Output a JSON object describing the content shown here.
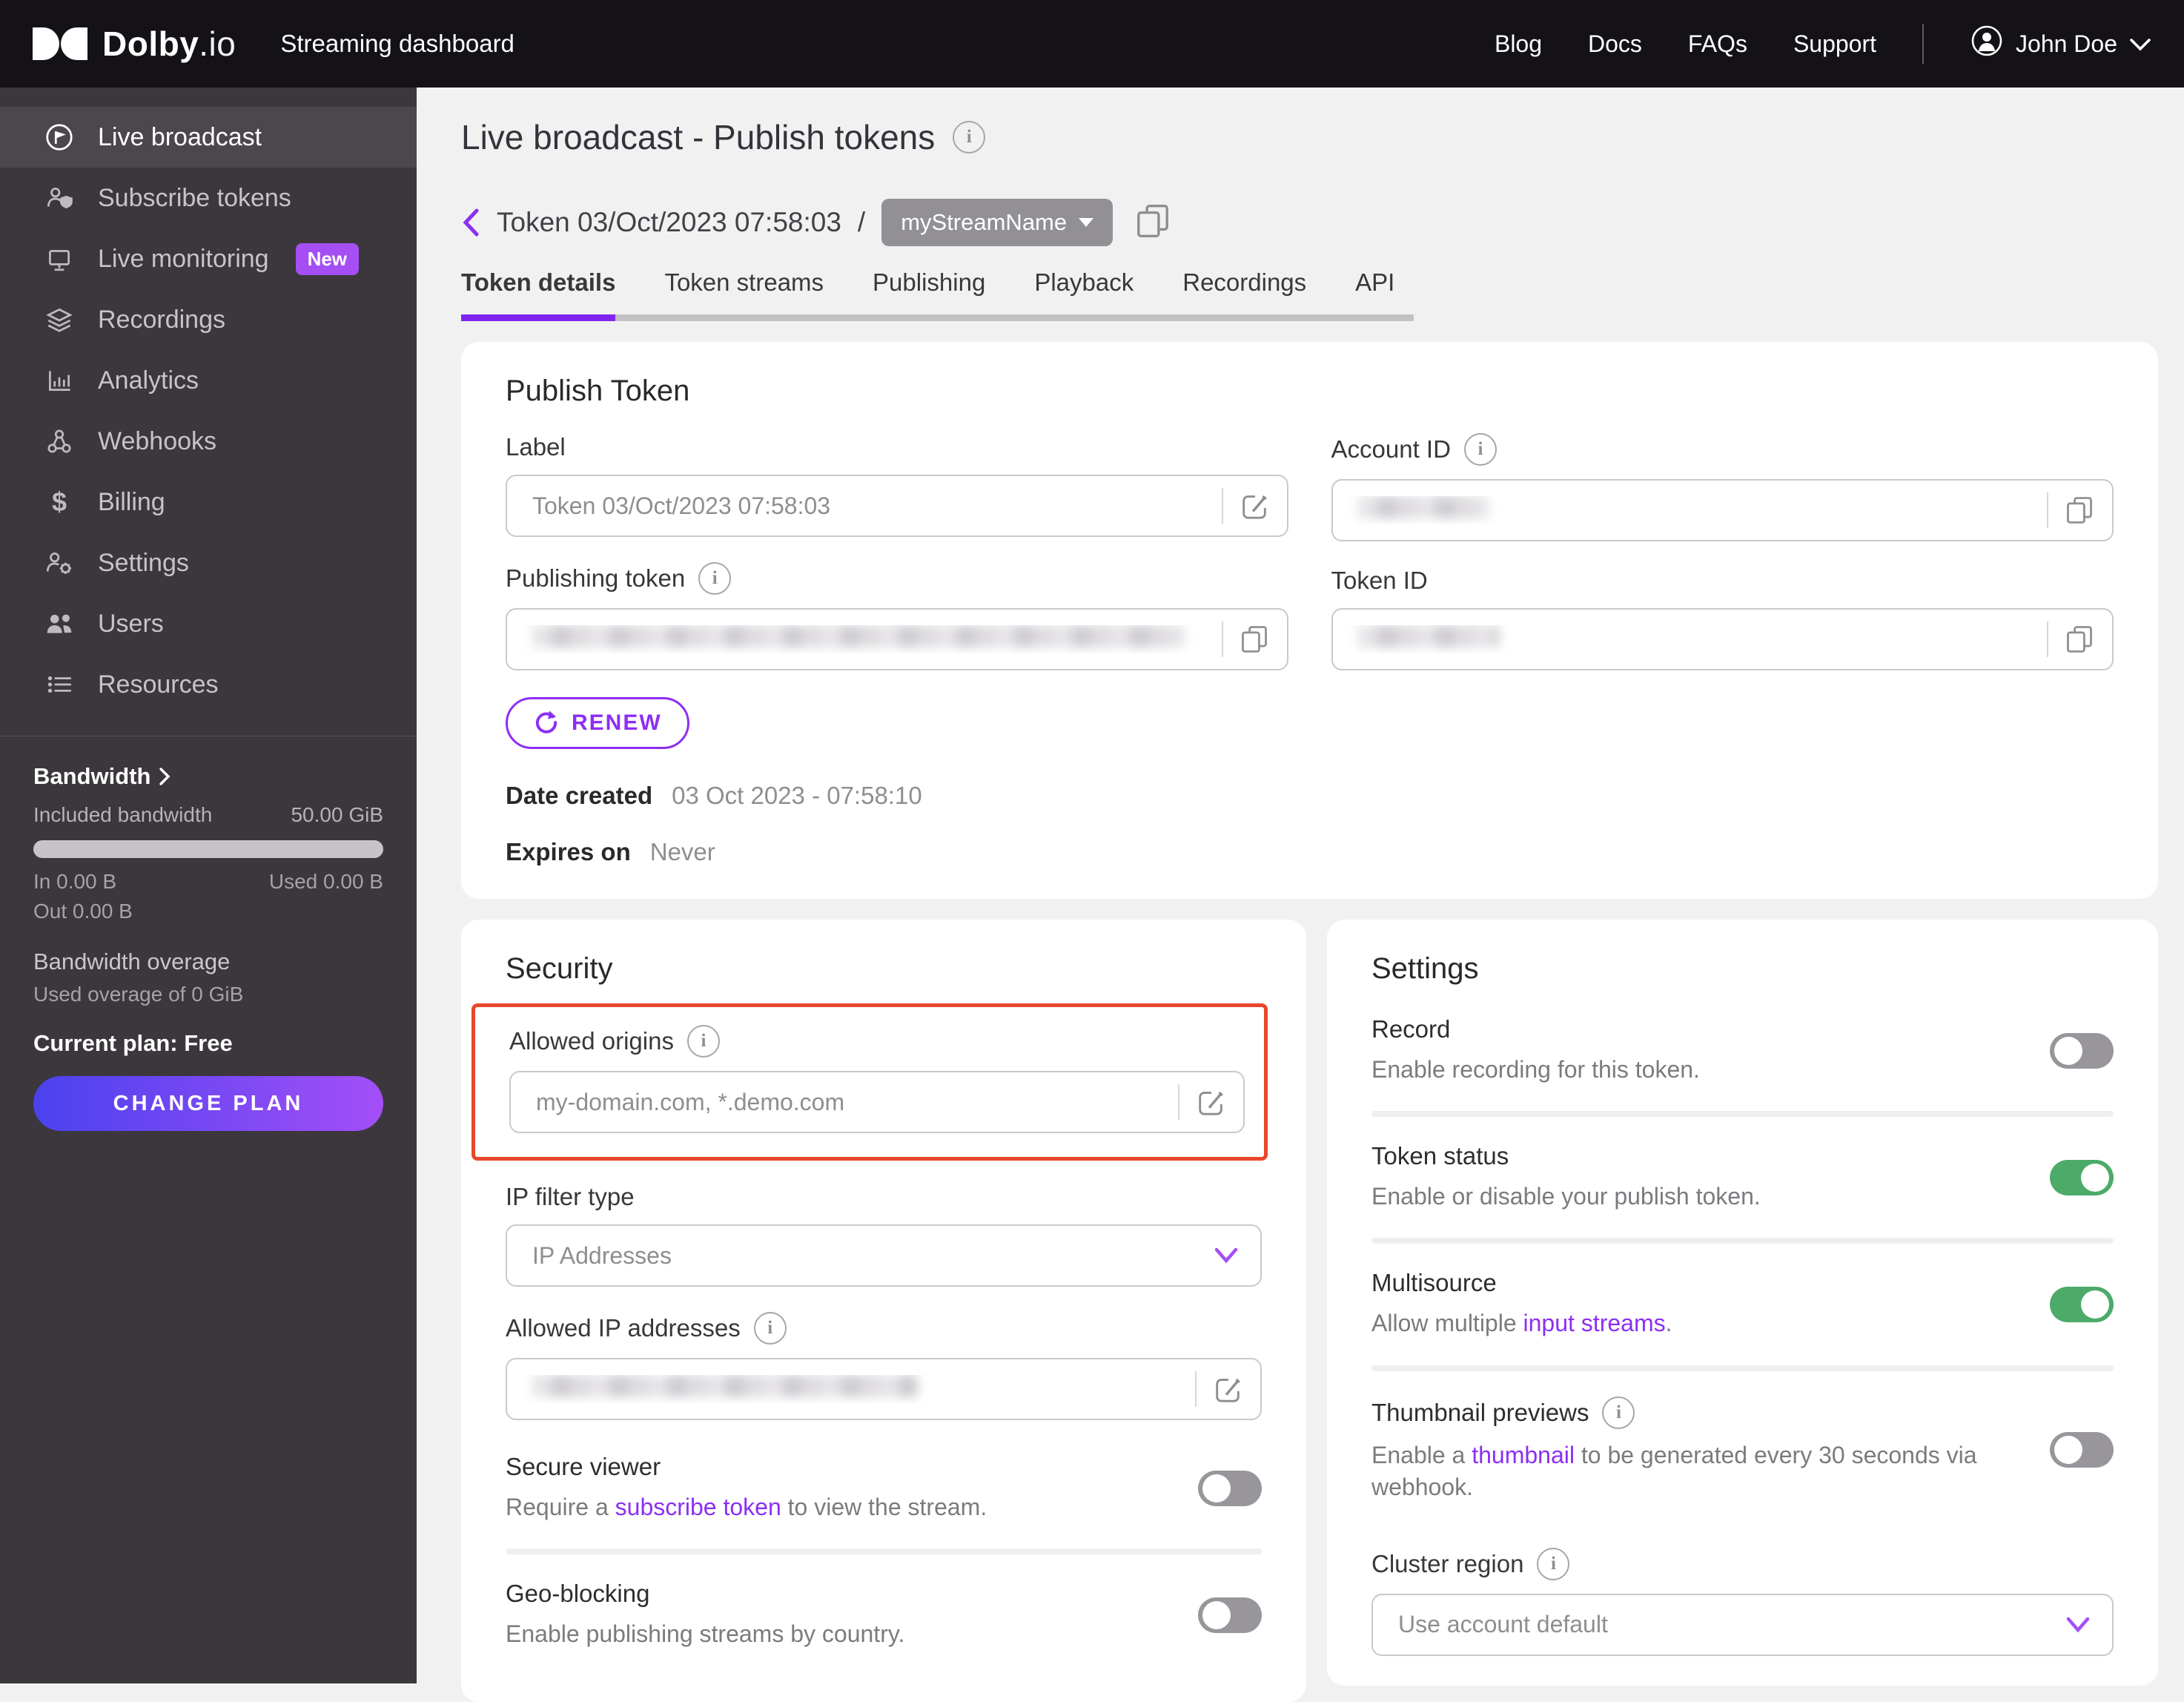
{
  "topbar": {
    "brand_bold": "Dolby",
    "brand_suffix": ".io",
    "product": "Streaming dashboard",
    "links": [
      {
        "label": "Blog"
      },
      {
        "label": "Docs"
      },
      {
        "label": "FAQs"
      },
      {
        "label": "Support"
      }
    ],
    "user": "John Doe"
  },
  "sidebar": {
    "items": [
      {
        "label": "Live broadcast"
      },
      {
        "label": "Subscribe tokens"
      },
      {
        "label": "Live monitoring",
        "badge": "New"
      },
      {
        "label": "Recordings"
      },
      {
        "label": "Analytics"
      },
      {
        "label": "Webhooks"
      },
      {
        "label": "Billing"
      },
      {
        "label": "Settings"
      },
      {
        "label": "Users"
      },
      {
        "label": "Resources"
      }
    ],
    "icons": {
      "billing": "$"
    },
    "bandwidth": {
      "title": "Bandwidth",
      "included_label": "Included bandwidth",
      "included_value": "50.00 GiB",
      "in": "In 0.00 B",
      "used": "Used 0.00 B",
      "out": "Out 0.00 B",
      "overage_title": "Bandwidth overage",
      "overage_desc": "Used overage of 0 GiB",
      "plan": "Current plan: Free",
      "change_plan": "CHANGE PLAN"
    }
  },
  "page": {
    "title": "Live broadcast - Publish tokens",
    "breadcrumb": {
      "token": "Token 03/Oct/2023 07:58:03",
      "separator": "/",
      "stream_pill": "myStreamName"
    },
    "tabs": [
      {
        "label": "Token details"
      },
      {
        "label": "Token streams"
      },
      {
        "label": "Publishing"
      },
      {
        "label": "Playback"
      },
      {
        "label": "Recordings"
      },
      {
        "label": "API"
      }
    ],
    "active_tab": "Token details"
  },
  "publish_token": {
    "heading": "Publish Token",
    "label_label": "Label",
    "label_value": "Token 03/Oct/2023 07:58:03",
    "account_id_label": "Account ID",
    "publishing_token_label": "Publishing token",
    "token_id_label": "Token ID",
    "renew_label": "RENEW",
    "date_created_label": "Date created",
    "date_created_value": "03 Oct 2023 - 07:58:10",
    "expires_label": "Expires on",
    "expires_value": "Never"
  },
  "security": {
    "heading": "Security",
    "allowed_origins_label": "Allowed origins",
    "allowed_origins_placeholder": "my-domain.com, *.demo.com",
    "ip_filter_label": "IP filter type",
    "ip_filter_value": "IP Addresses",
    "allowed_ip_label": "Allowed IP addresses",
    "secure_viewer": {
      "title": "Secure viewer",
      "desc_prefix": "Require a ",
      "link": "subscribe token",
      "desc_suffix": " to view the stream.",
      "enabled": false
    },
    "geo_blocking": {
      "title": "Geo-blocking",
      "desc": "Enable publishing streams by country.",
      "enabled": false
    }
  },
  "settings": {
    "heading": "Settings",
    "record": {
      "title": "Record",
      "desc": "Enable recording for this token.",
      "enabled": false
    },
    "token_status": {
      "title": "Token status",
      "desc": "Enable or disable your publish token.",
      "enabled": true
    },
    "multisource": {
      "title": "Multisource",
      "desc_prefix": "Allow multiple ",
      "link": "input streams",
      "desc_suffix": ".",
      "enabled": true
    },
    "thumbnail": {
      "title": "Thumbnail previews",
      "desc_prefix": "Enable a ",
      "link": "thumbnail",
      "desc_suffix": " to be generated every 30 seconds via webhook.",
      "enabled": false
    },
    "cluster_region": {
      "label": "Cluster region",
      "value": "Use account default"
    }
  },
  "colors": {
    "accent_purple": "#8C2FF2",
    "tab_underline_purple": "#7F24EF",
    "badge_purple": "#A44EF4",
    "toggle_on_green": "#4CAB68",
    "toggle_off_gray": "#98969B",
    "highlight_red": "#E8472B",
    "plan_gradient_start": "#4A42EE",
    "plan_gradient_end": "#A44EF8"
  }
}
